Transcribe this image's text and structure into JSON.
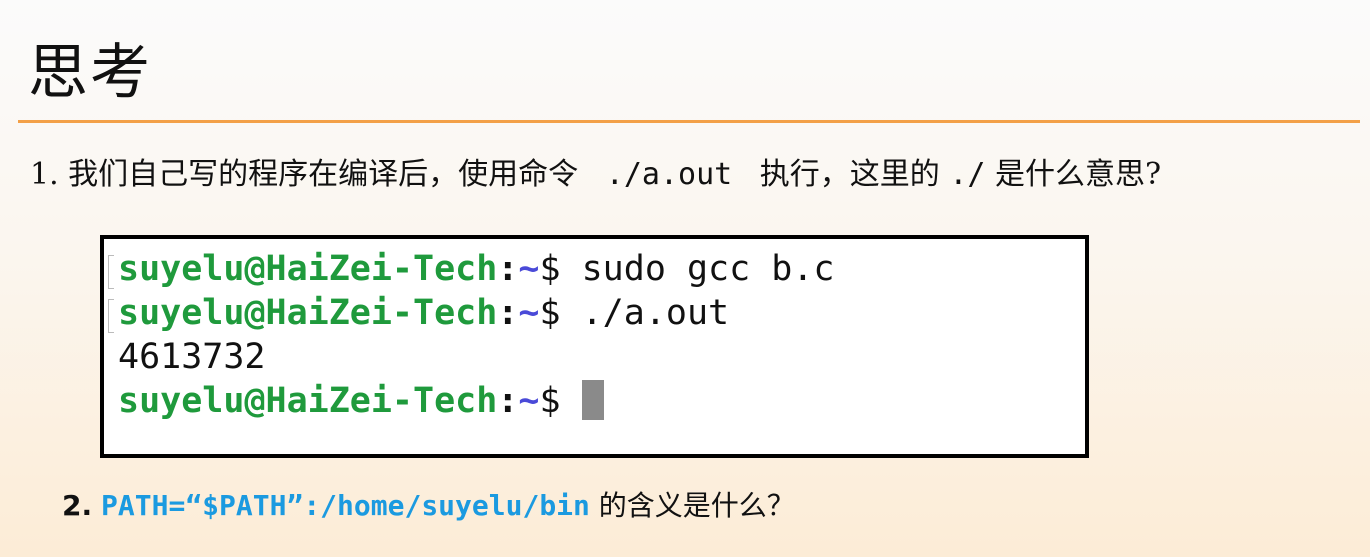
{
  "slide": {
    "title": "思考",
    "accent_color": "#f3a048",
    "question1": {
      "prefix": "1. 我们自己写的程序在编译后，使用命令 ",
      "command": " ./a.out ",
      "middle": " 执行，这里的 ",
      "dot_slash": "./",
      "suffix": " 是什么意思?"
    },
    "terminal": {
      "prompt_user_host": "suyelu@HaiZei-Tech",
      "prompt_colon": ":",
      "prompt_tilde": "~",
      "prompt_dollar": "$ ",
      "lines": [
        {
          "command": "sudo gcc b.c"
        },
        {
          "command": "./a.out"
        }
      ],
      "output": "4613732",
      "colors": {
        "prompt": "#1f9a3c",
        "tilde": "#4a4ad8",
        "cursor": "#8a8a8a"
      }
    },
    "question2": {
      "number": "2.",
      "code": "PATH=“$PATH”:/home/suyelu/bin",
      "suffix": " 的含义是什么？",
      "code_color": "#1b9ae0"
    }
  }
}
